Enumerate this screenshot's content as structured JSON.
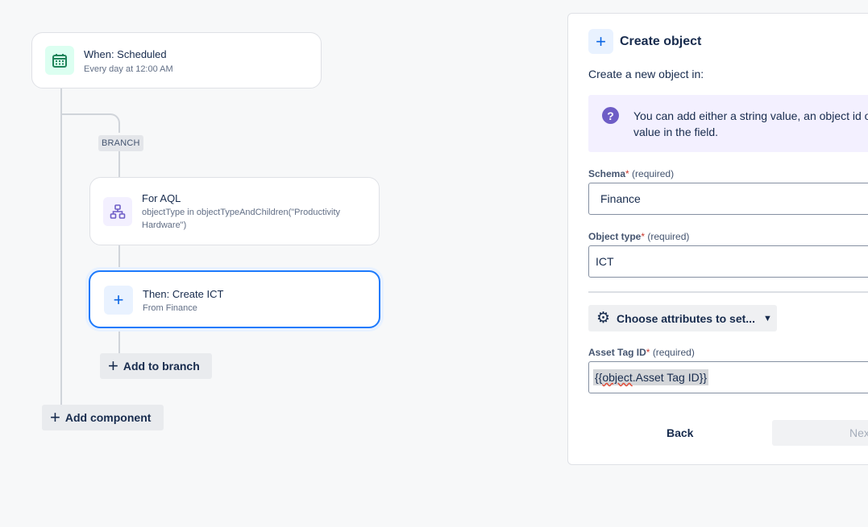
{
  "flow": {
    "trigger": {
      "title": "When: Scheduled",
      "subtitle": "Every day at 12:00 AM"
    },
    "branch_label": "BRANCH",
    "aql": {
      "title": "For AQL",
      "subtitle": "objectType in objectTypeAndChildren(\"Productivity Hardware\")"
    },
    "action": {
      "title": "Then: Create ICT",
      "subtitle": "From Finance"
    },
    "add_to_branch": "Add to branch",
    "add_component": "Add component"
  },
  "panel": {
    "title": "Create object",
    "subtitle": "Create a new object in:",
    "info_line1": "You can add either a string value, an object id o",
    "info_line2": "value in the field.",
    "schema": {
      "label": "Schema",
      "required": "(required)",
      "value": "Finance"
    },
    "object_type": {
      "label": "Object type",
      "required": "(required)",
      "value": "ICT"
    },
    "attributes_button": "Choose attributes to set...",
    "asset_tag": {
      "label": "Asset Tag ID",
      "required": "(required)",
      "value_prefix": "{{",
      "value_word": "object",
      "value_rest": ".Asset Tag ID}}"
    },
    "back": "Back",
    "next": "Next"
  },
  "icons": [
    "calendar-icon",
    "hierarchy-icon",
    "plus-icon",
    "question-icon",
    "gear-icon",
    "chevron-down-icon"
  ],
  "colors": {
    "accent": "#1d7afc",
    "trigger_icon_bg": "#dcfff1",
    "trigger_icon": "#1f845a",
    "aql_icon": "#6e5dc6",
    "info_bg": "#f3f0ff"
  }
}
